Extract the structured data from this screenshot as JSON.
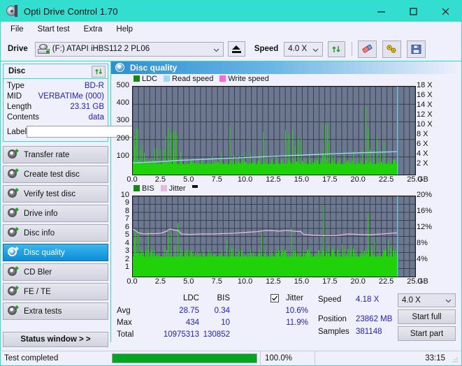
{
  "window": {
    "title": "Opti Drive Control 1.70",
    "icon": "disc-drive-icon",
    "minimize": "–",
    "maximize": "□",
    "close": "✕"
  },
  "menu": {
    "items": [
      "File",
      "Start test",
      "Extra",
      "Help"
    ]
  },
  "toolbar": {
    "drive_label": "Drive",
    "drive_value": "(F:)  ATAPI iHBS112  2 PL06",
    "eject_title": "eject-icon",
    "speed_label": "Speed",
    "speed_value": "4.0 X",
    "refresh_icon": "refresh-icon",
    "eraser_icon": "eraser-icon",
    "tools_icon": "tools-icon",
    "save_icon": "save-icon"
  },
  "disc_panel": {
    "title": "Disc",
    "refresh_icon": "refresh-icon",
    "rows": [
      {
        "key": "Type",
        "value": "BD-R"
      },
      {
        "key": "MID",
        "value": "VERBATIMe (000)"
      },
      {
        "key": "Length",
        "value": "23.31 GB"
      },
      {
        "key": "Contents",
        "value": "data"
      }
    ],
    "label_key": "Label",
    "label_value": "",
    "label_placeholder": "",
    "label_button_icon": "disc-icon"
  },
  "sidebar": {
    "items": [
      {
        "label": "Transfer rate",
        "selected": false,
        "icon": "disc-test-icon"
      },
      {
        "label": "Create test disc",
        "selected": false,
        "icon": "disc-test-icon"
      },
      {
        "label": "Verify test disc",
        "selected": false,
        "icon": "disc-test-icon"
      },
      {
        "label": "Drive info",
        "selected": false,
        "icon": "disc-test-icon"
      },
      {
        "label": "Disc info",
        "selected": false,
        "icon": "disc-test-icon"
      },
      {
        "label": "Disc quality",
        "selected": true,
        "icon": "disc-test-icon"
      },
      {
        "label": "CD Bler",
        "selected": false,
        "icon": "disc-test-icon"
      },
      {
        "label": "FE / TE",
        "selected": false,
        "icon": "disc-test-icon"
      },
      {
        "label": "Extra tests",
        "selected": false,
        "icon": "disc-test-icon"
      }
    ],
    "status_window": "Status window > >"
  },
  "main": {
    "header_title": "Disc quality",
    "header_icon": "disc-quality-icon"
  },
  "stats": {
    "col_headers": [
      "LDC",
      "BIS"
    ],
    "row_labels": [
      "Avg",
      "Max",
      "Total"
    ],
    "ldc": {
      "avg": "28.75",
      "max": "434",
      "total": "10975313"
    },
    "bis": {
      "avg": "0.34",
      "max": "10",
      "total": "130852"
    },
    "jitter": {
      "checked": true,
      "label": "Jitter",
      "avg": "10.6%",
      "max": "11.9%"
    },
    "speed_label": "Speed",
    "speed_value": "4.18 X",
    "position_label": "Position",
    "position_value": "23862 MB",
    "samples_label": "Samples",
    "samples_value": "381148",
    "speed_select": "4.0 X",
    "start_full": "Start full",
    "start_part": "Start part"
  },
  "statusbar": {
    "message": "Test completed",
    "progress_percent": 100.0,
    "progress_text": "100.0%",
    "elapsed": "33:15"
  },
  "colors": {
    "accent": "#33ded0",
    "ldc_green": "#1fd20a",
    "read_speed": "#9fd9f5",
    "write_speed": "#ff66dd",
    "jitter_pink": "#e5b8e0",
    "plot_bg": "#6c7790",
    "value_blue": "#2020cf",
    "selected_nav": "#0d8bd6",
    "progress_green": "#00a61e"
  },
  "chart_data": [
    {
      "type": "area",
      "title": "LDC / Read speed / Write speed",
      "xlabel": "GB",
      "ylabel": "LDC",
      "xlim": [
        0.0,
        25.0
      ],
      "ylim": [
        0,
        500
      ],
      "y2lim": [
        0,
        18
      ],
      "y2label": "X",
      "xticks": [
        "0.0",
        "2.5",
        "5.0",
        "7.5",
        "10.0",
        "12.5",
        "15.0",
        "17.5",
        "20.0",
        "22.5",
        "25.0"
      ],
      "yticks": [
        "100",
        "200",
        "300",
        "400",
        "500"
      ],
      "y2ticks": [
        "2 X",
        "4 X",
        "6 X",
        "8 X",
        "10 X",
        "12 X",
        "14 X",
        "16 X",
        "18 X"
      ],
      "xunit": "GB",
      "grid": true,
      "legend": [
        {
          "name": "LDC",
          "color": "#1fd20a"
        },
        {
          "name": "Read speed",
          "color": "#9fd9f5"
        },
        {
          "name": "Write speed",
          "color": "#ff66dd"
        }
      ],
      "data_end_gb": 23.4,
      "series": [
        {
          "name": "LDC",
          "type": "bars",
          "color": "#1fd20a",
          "baseline": 60,
          "peaks": [
            [
              0.15,
              390
            ],
            [
              0.3,
              310
            ],
            [
              0.45,
              360
            ],
            [
              0.6,
              200
            ],
            [
              0.8,
              175
            ],
            [
              1.0,
              150
            ],
            [
              1.2,
              130
            ],
            [
              1.5,
              120
            ],
            [
              1.9,
              215
            ],
            [
              2.1,
              165
            ],
            [
              2.4,
              190
            ],
            [
              2.7,
              230
            ],
            [
              2.9,
              255
            ],
            [
              3.1,
              300
            ],
            [
              3.35,
              280
            ],
            [
              3.55,
              395
            ],
            [
              3.7,
              320
            ],
            [
              3.9,
              240
            ],
            [
              4.2,
              150
            ],
            [
              4.6,
              120
            ],
            [
              5.1,
              135
            ],
            [
              5.6,
              110
            ],
            [
              6.1,
              165
            ],
            [
              6.6,
              115
            ],
            [
              7.0,
              120
            ],
            [
              7.4,
              150
            ],
            [
              7.8,
              130
            ],
            [
              8.2,
              115
            ],
            [
              8.55,
              335
            ],
            [
              8.9,
              140
            ],
            [
              9.4,
              120
            ],
            [
              9.9,
              130
            ],
            [
              10.4,
              135
            ],
            [
              10.8,
              120
            ],
            [
              11.2,
              125
            ],
            [
              11.5,
              290
            ],
            [
              11.9,
              140
            ],
            [
              12.3,
              120
            ],
            [
              12.7,
              145
            ],
            [
              13.1,
              135
            ],
            [
              13.5,
              305
            ],
            [
              13.8,
              230
            ],
            [
              14.1,
              300
            ],
            [
              14.35,
              180
            ],
            [
              14.6,
              215
            ],
            [
              14.9,
              260
            ],
            [
              15.2,
              150
            ],
            [
              15.6,
              130
            ],
            [
              16.0,
              150
            ],
            [
              16.4,
              130
            ],
            [
              16.8,
              250
            ],
            [
              17.0,
              410
            ],
            [
              17.2,
              300
            ],
            [
              17.4,
              230
            ],
            [
              17.6,
              190
            ],
            [
              17.9,
              150
            ],
            [
              18.3,
              130
            ],
            [
              18.7,
              145
            ],
            [
              19.1,
              130
            ],
            [
              19.5,
              150
            ],
            [
              19.9,
              175
            ],
            [
              20.3,
              155
            ],
            [
              20.6,
              430
            ],
            [
              20.8,
              300
            ],
            [
              21.0,
              225
            ],
            [
              21.3,
              160
            ],
            [
              21.6,
              220
            ],
            [
              21.9,
              150
            ],
            [
              22.2,
              245
            ],
            [
              22.5,
              165
            ],
            [
              22.8,
              140
            ],
            [
              23.1,
              130
            ]
          ]
        },
        {
          "name": "Read speed",
          "type": "line",
          "color": "#9fd9f5",
          "points": [
            [
              0.0,
              2.4
            ],
            [
              2.0,
              2.6
            ],
            [
              4.0,
              2.9
            ],
            [
              6.0,
              3.1
            ],
            [
              8.0,
              3.3
            ],
            [
              10.0,
              3.5
            ],
            [
              12.0,
              3.7
            ],
            [
              14.0,
              3.9
            ],
            [
              16.0,
              4.1
            ],
            [
              18.0,
              4.3
            ],
            [
              20.0,
              4.45
            ],
            [
              22.0,
              4.6
            ],
            [
              23.4,
              4.7
            ]
          ],
          "axis": "right"
        },
        {
          "name": "Write speed",
          "type": "line",
          "color": "#ff66dd",
          "points": []
        }
      ],
      "cursor_gb": 23.45
    },
    {
      "type": "area",
      "title": "BIS / Jitter",
      "xlabel": "GB",
      "ylabel": "BIS",
      "xlim": [
        0.0,
        25.0
      ],
      "ylim": [
        0,
        10
      ],
      "y2lim": [
        0,
        20
      ],
      "y2label": "%",
      "xticks": [
        "0.0",
        "2.5",
        "5.0",
        "7.5",
        "10.0",
        "12.5",
        "15.0",
        "17.5",
        "20.0",
        "22.5",
        "25.0"
      ],
      "yticks": [
        "1",
        "2",
        "3",
        "4",
        "5",
        "6",
        "7",
        "8",
        "9",
        "10"
      ],
      "y2ticks": [
        "4%",
        "8%",
        "12%",
        "16%",
        "20%"
      ],
      "xunit": "GB",
      "grid": true,
      "legend": [
        {
          "name": "BIS",
          "color": "#1fd20a"
        },
        {
          "name": "Jitter",
          "color": "#e5b8e0"
        }
      ],
      "data_end_gb": 23.4,
      "series": [
        {
          "name": "BIS",
          "type": "bars",
          "color": "#1fd20a",
          "baseline": 2.5,
          "peaks": [
            [
              0.1,
              8.0
            ],
            [
              0.2,
              7.2
            ],
            [
              0.35,
              9.1
            ],
            [
              0.5,
              6.0
            ],
            [
              0.7,
              4.3
            ],
            [
              0.9,
              3.6
            ],
            [
              1.1,
              4.1
            ],
            [
              1.35,
              7.0
            ],
            [
              1.6,
              4.0
            ],
            [
              1.9,
              3.8
            ],
            [
              2.2,
              4.1
            ],
            [
              2.5,
              3.9
            ],
            [
              2.8,
              5.1
            ],
            [
              3.1,
              5.8
            ],
            [
              3.4,
              6.0
            ],
            [
              3.7,
              5.0
            ],
            [
              3.95,
              8.1
            ],
            [
              4.3,
              4.2
            ],
            [
              4.7,
              3.4
            ],
            [
              5.2,
              3.3
            ],
            [
              5.7,
              3.2
            ],
            [
              6.2,
              3.4
            ],
            [
              6.7,
              3.3
            ],
            [
              7.2,
              3.2
            ],
            [
              7.7,
              3.4
            ],
            [
              8.3,
              5.2
            ],
            [
              8.8,
              3.3
            ],
            [
              9.3,
              3.2
            ],
            [
              9.8,
              4.0
            ],
            [
              10.3,
              3.3
            ],
            [
              10.8,
              3.5
            ],
            [
              11.4,
              7.0
            ],
            [
              11.9,
              3.4
            ],
            [
              12.4,
              3.3
            ],
            [
              12.9,
              7.1
            ],
            [
              13.1,
              5.5
            ],
            [
              13.5,
              4.0
            ],
            [
              14.0,
              8.1
            ],
            [
              14.4,
              4.2
            ],
            [
              14.8,
              3.6
            ],
            [
              15.2,
              3.4
            ],
            [
              15.6,
              4.1
            ],
            [
              16.0,
              3.5
            ],
            [
              16.4,
              3.3
            ],
            [
              16.9,
              10.0
            ],
            [
              17.3,
              7.0
            ],
            [
              17.7,
              3.6
            ],
            [
              18.1,
              3.4
            ],
            [
              18.5,
              4.2
            ],
            [
              18.9,
              3.5
            ],
            [
              19.3,
              4.4
            ],
            [
              19.7,
              3.4
            ],
            [
              20.1,
              3.6
            ],
            [
              20.5,
              4.5
            ],
            [
              20.8,
              9.1
            ],
            [
              21.1,
              4.0
            ],
            [
              21.4,
              6.0
            ],
            [
              21.7,
              3.5
            ],
            [
              22.0,
              4.2
            ],
            [
              22.3,
              3.6
            ],
            [
              22.6,
              6.0
            ],
            [
              22.9,
              4.2
            ],
            [
              23.2,
              3.5
            ]
          ]
        },
        {
          "name": "Jitter",
          "type": "line",
          "color": "#e5b8e0",
          "axis": "right",
          "points": [
            [
              0.0,
              11.8
            ],
            [
              0.5,
              10.9
            ],
            [
              1.0,
              10.6
            ],
            [
              1.5,
              10.7
            ],
            [
              2.0,
              10.7
            ],
            [
              2.5,
              10.8
            ],
            [
              3.0,
              11.3
            ],
            [
              3.3,
              11.9
            ],
            [
              3.6,
              11.6
            ],
            [
              4.0,
              11.5
            ],
            [
              4.3,
              10.6
            ],
            [
              5.0,
              10.5
            ],
            [
              6.0,
              10.6
            ],
            [
              7.0,
              10.6
            ],
            [
              8.0,
              10.7
            ],
            [
              9.0,
              10.8
            ],
            [
              10.0,
              11.0
            ],
            [
              11.0,
              11.2
            ],
            [
              11.8,
              11.5
            ],
            [
              12.5,
              11.4
            ],
            [
              13.0,
              11.3
            ],
            [
              13.6,
              11.5
            ],
            [
              14.3,
              11.3
            ],
            [
              14.9,
              11.2
            ],
            [
              15.1,
              10.5
            ],
            [
              16.0,
              10.3
            ],
            [
              17.0,
              10.2
            ],
            [
              18.0,
              10.2
            ],
            [
              19.0,
              10.6
            ],
            [
              20.0,
              10.5
            ],
            [
              21.0,
              10.4
            ],
            [
              22.0,
              10.6
            ],
            [
              23.0,
              10.8
            ],
            [
              23.4,
              10.9
            ]
          ]
        }
      ],
      "cursor_gb": 23.45
    }
  ]
}
